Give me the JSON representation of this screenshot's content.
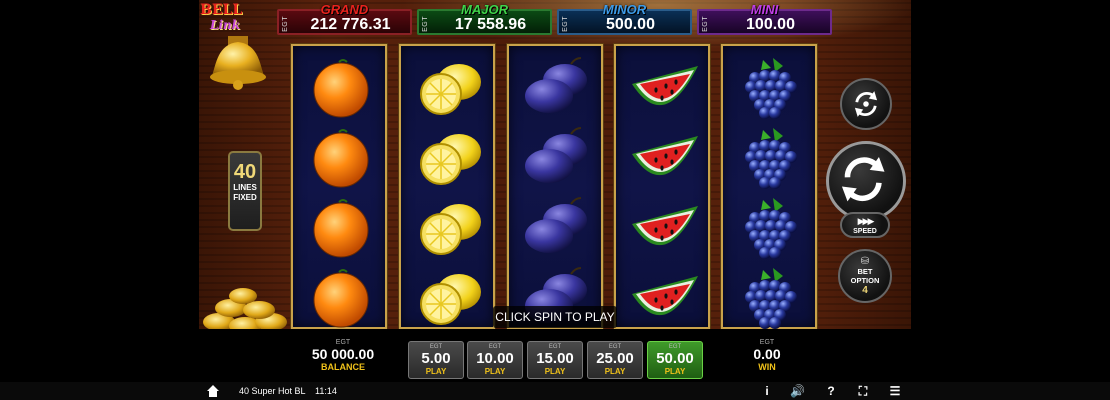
{
  "logo": {
    "line1": "BELL",
    "line2": "Link"
  },
  "jackpots": [
    {
      "name": "GRAND",
      "egt": "EGT",
      "value": "212 776.31",
      "color": "#e8231d"
    },
    {
      "name": "MAJOR",
      "egt": "EGT",
      "value": "17 558.96",
      "color": "#3fd44a"
    },
    {
      "name": "MINOR",
      "egt": "EGT",
      "value": "500.00",
      "color": "#3d9be8"
    },
    {
      "name": "MINI",
      "egt": "EGT",
      "value": "100.00",
      "color": "#c13ee6"
    }
  ],
  "lines": {
    "count": "40",
    "label1": "LINES",
    "label2": "FIXED"
  },
  "reels": [
    [
      "orange-icon",
      "orange-icon",
      "orange-icon",
      "orange-icon"
    ],
    [
      "lemon-icon",
      "lemon-icon",
      "lemon-icon",
      "lemon-icon"
    ],
    [
      "plum-icon",
      "plum-icon",
      "plum-icon",
      "plum-icon"
    ],
    [
      "watermelon-icon",
      "watermelon-icon",
      "watermelon-icon",
      "watermelon-icon"
    ],
    [
      "grapes-icon",
      "grapes-icon",
      "grapes-icon",
      "grapes-icon"
    ]
  ],
  "hint": "CLICK SPIN TO PLAY",
  "controls": {
    "speed_label": "SPEED",
    "bet_option_label1": "BET",
    "bet_option_label2": "OPTION",
    "bet_option_value": "4"
  },
  "balance": {
    "egt": "EGT",
    "amount": "50 000.00",
    "label": "BALANCE"
  },
  "win": {
    "egt": "EGT",
    "amount": "0.00",
    "label": "WIN"
  },
  "bets": [
    {
      "egt": "EGT",
      "amount": "5.00",
      "label": "PLAY",
      "active": false
    },
    {
      "egt": "EGT",
      "amount": "10.00",
      "label": "PLAY",
      "active": false
    },
    {
      "egt": "EGT",
      "amount": "15.00",
      "label": "PLAY",
      "active": false
    },
    {
      "egt": "EGT",
      "amount": "25.00",
      "label": "PLAY",
      "active": false
    },
    {
      "egt": "EGT",
      "amount": "50.00",
      "label": "PLAY",
      "active": true
    }
  ],
  "footer": {
    "game_name": "40 Super Hot BL",
    "time": "11:14"
  }
}
